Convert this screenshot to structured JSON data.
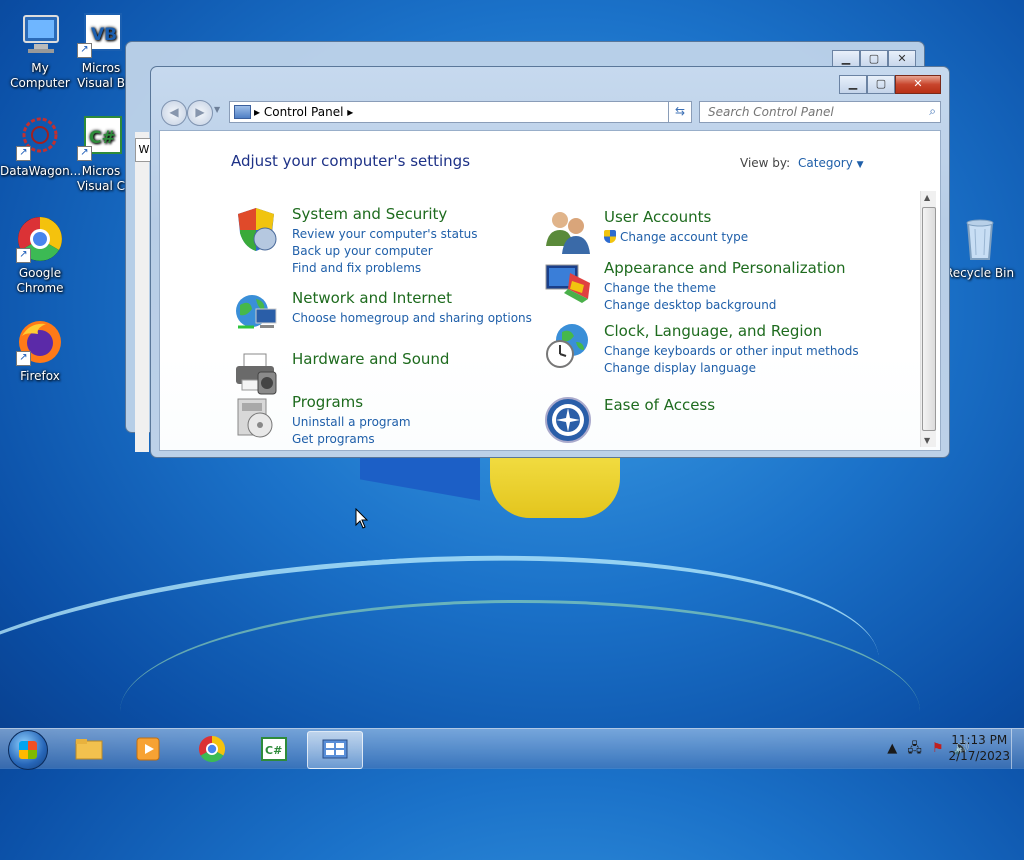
{
  "colors": {
    "accent": "#1f5fa9",
    "category_title": "#1e6b1e",
    "page_title": "#1e3287"
  },
  "desktop": {
    "icons": [
      {
        "label": "My Computer",
        "icon": "computer-icon"
      },
      {
        "label": "Micros Visual B",
        "icon": "visual-basic-icon"
      },
      {
        "label": "DataWagon...",
        "icon": "datawagon-icon"
      },
      {
        "label": "Micros Visual C",
        "icon": "visual-csharp-icon"
      },
      {
        "label": "Google Chrome",
        "icon": "chrome-icon"
      },
      {
        "label": "Firefox",
        "icon": "firefox-icon"
      },
      {
        "label": "Recycle Bin",
        "icon": "recycle-bin-icon"
      }
    ],
    "vb_badge": "VB",
    "cs_badge": "C#"
  },
  "behind_window": {
    "tab_letter": "W"
  },
  "window": {
    "address": {
      "path": "Control Panel",
      "separator": "▸"
    },
    "search": {
      "placeholder": "Search Control Panel"
    },
    "page_title": "Adjust your computer's settings",
    "view_by": {
      "label": "View by:",
      "value": "Category"
    },
    "categories": [
      {
        "icon": "shield-icon",
        "title": "System and Security",
        "links": [
          "Review your computer's status",
          "Back up your computer",
          "Find and fix problems"
        ]
      },
      {
        "icon": "network-icon",
        "title": "Network and Internet",
        "links": [
          "Choose homegroup and sharing options"
        ]
      },
      {
        "icon": "printer-icon",
        "title": "Hardware and Sound",
        "links": []
      },
      {
        "icon": "programs-icon",
        "title": "Programs",
        "links": [
          "Uninstall a program",
          "Get programs"
        ]
      },
      {
        "icon": "users-icon",
        "title": "User Accounts",
        "links": [
          "Change account type"
        ]
      },
      {
        "icon": "monitor-palette-icon",
        "title": "Appearance and Personalization",
        "links": [
          "Change the theme",
          "Change desktop background"
        ]
      },
      {
        "icon": "globe-clock-icon",
        "title": "Clock, Language, and Region",
        "links": [
          "Change keyboards or other input methods",
          "Change display language"
        ]
      },
      {
        "icon": "ease-of-access-icon",
        "title": "Ease of Access",
        "links": []
      }
    ]
  },
  "taskbar": {
    "items": [
      "file-explorer-icon",
      "media-player-icon",
      "chrome-icon",
      "visual-csharp-icon",
      "control-panel-icon"
    ],
    "clock": {
      "time": "11:13 PM",
      "date": "2/17/2023"
    },
    "tray": {
      "expand": "▲"
    }
  }
}
